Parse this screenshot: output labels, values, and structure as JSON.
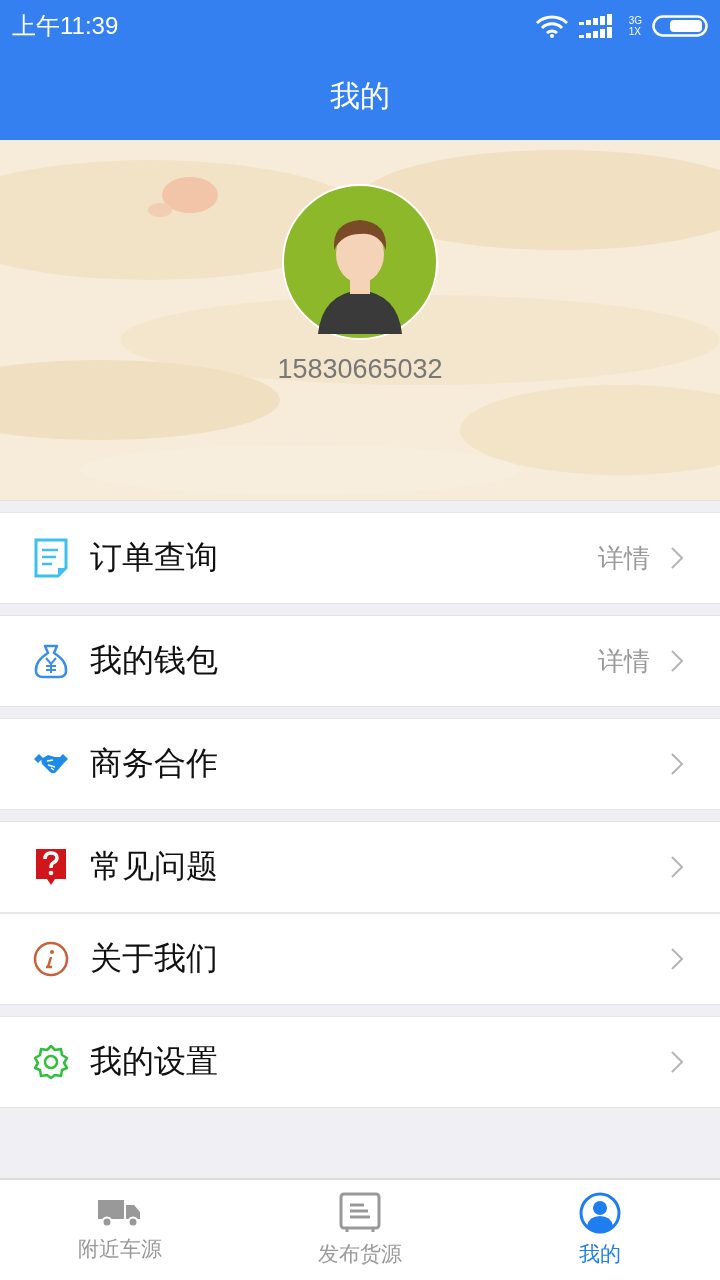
{
  "status_bar": {
    "time": "上午11:39",
    "network_top": "3G",
    "network_bottom": "1X"
  },
  "header": {
    "title": "我的"
  },
  "profile": {
    "phone": "15830665032"
  },
  "menu_groups": [
    [
      {
        "label": "订单查询",
        "detail": "详情"
      }
    ],
    [
      {
        "label": "我的钱包",
        "detail": "详情"
      }
    ],
    [
      {
        "label": "商务合作"
      }
    ],
    [
      {
        "label": "常见问题"
      },
      {
        "label": "关于我们"
      }
    ],
    [
      {
        "label": "我的设置"
      }
    ]
  ],
  "tab_bar": [
    {
      "label": "附近车源",
      "selected": false
    },
    {
      "label": "发布货源",
      "selected": false
    },
    {
      "label": "我的",
      "selected": true
    }
  ]
}
